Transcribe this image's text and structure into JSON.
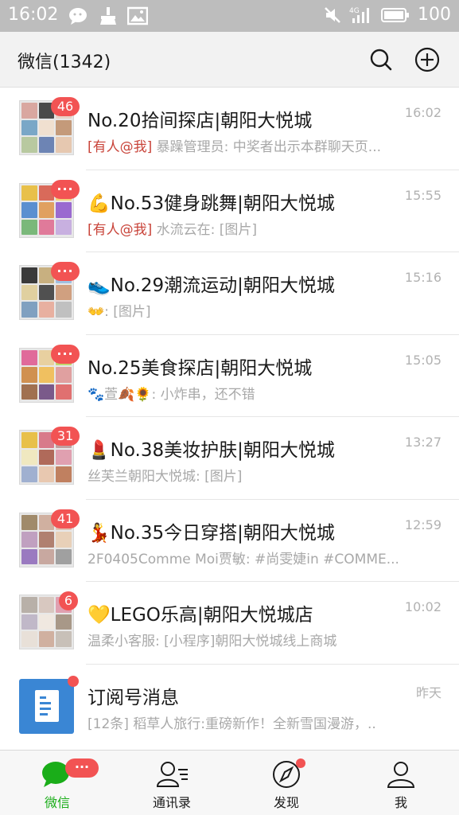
{
  "status_bar": {
    "time": "16:02",
    "battery": "100",
    "network": "4G"
  },
  "header": {
    "title": "微信(1342)"
  },
  "chats": [
    {
      "name": " No.20拾间探店|朝阳大悦城",
      "time": "16:02",
      "badge": "46",
      "mention": "[有人@我]",
      "preview": " 暴躁管理员: 中奖者出示本群聊天页..."
    },
    {
      "name": "💪No.53健身跳舞|朝阳大悦城",
      "time": "15:55",
      "badge": "···",
      "mention": "[有人@我]",
      "preview": " 水流云在: [图片]"
    },
    {
      "name": "👟No.29潮流运动|朝阳大悦城",
      "time": "15:16",
      "badge": "···",
      "mention": "",
      "preview": "👐: [图片]"
    },
    {
      "name": " No.25美食探店|朝阳大悦城",
      "time": "15:05",
      "badge": "···",
      "mention": "",
      "preview": "🐾萱🍂🌻: 小炸串，还不错"
    },
    {
      "name": "💄No.38美妆护肤|朝阳大悦城",
      "time": "13:27",
      "badge": "31",
      "mention": "",
      "preview": "丝芙兰朝阳大悦城: [图片]"
    },
    {
      "name": "💃No.35今日穿搭|朝阳大悦城",
      "time": "12:59",
      "badge": "41",
      "mention": "",
      "preview": "2F0405Comme Moi贾敏: #尚雯婕in #COMME..."
    },
    {
      "name": "💛LEGO乐高|朝阳大悦城店",
      "time": "10:02",
      "badge": "6",
      "mention": "",
      "preview": "温柔小客服: [小程序]朝阳大悦城线上商城"
    },
    {
      "name": "订阅号消息",
      "time": "昨天",
      "badge": "",
      "mention": "",
      "preview": "[12条] 稻草人旅行:重磅新作！全新雪国漫游，.."
    }
  ],
  "tabs": [
    {
      "label": "微信",
      "badge": "···"
    },
    {
      "label": "通讯录"
    },
    {
      "label": "发现"
    },
    {
      "label": "我"
    }
  ],
  "colors": {
    "accent_green": "#1aad19",
    "badge_red": "#f25353",
    "mention_red": "#c9443a",
    "header_bg": "#f2f2f2",
    "status_bg": "#bdbdbd"
  }
}
